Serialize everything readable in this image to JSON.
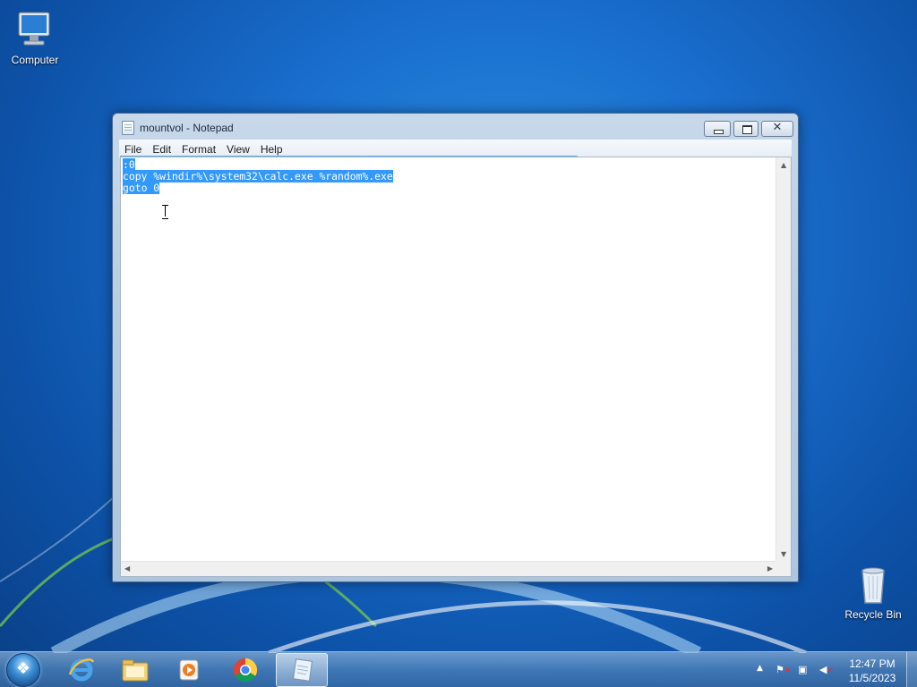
{
  "desktop": {
    "icons": [
      {
        "label": "Computer",
        "icon": "computer-icon"
      },
      {
        "label": "Recycle Bin",
        "icon": "recycle-bin-icon"
      }
    ]
  },
  "window": {
    "title": "mountvol - Notepad",
    "menu": [
      "File",
      "Edit",
      "Format",
      "View",
      "Help"
    ],
    "content_lines": [
      ":0",
      "copy %windir%\\system32\\calc.exe %random%.exe",
      "goto 0"
    ],
    "selection": "all"
  },
  "taskbar": {
    "pinned": [
      {
        "name": "internet-explorer-icon"
      },
      {
        "name": "windows-explorer-icon"
      },
      {
        "name": "media-player-icon"
      },
      {
        "name": "chrome-icon"
      },
      {
        "name": "notepad-icon",
        "active": true
      }
    ],
    "clock": {
      "time": "12:47 PM",
      "date": "11/5/2023"
    }
  },
  "colors": {
    "selection": "#3399ff",
    "desktop": "#1a6fcf"
  }
}
